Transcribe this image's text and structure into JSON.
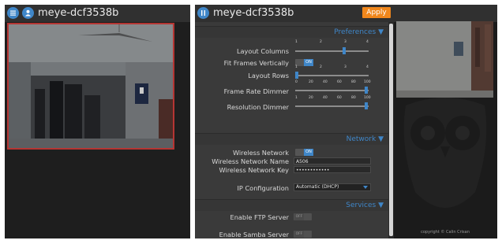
{
  "left": {
    "menu_icon": "hamburger-icon",
    "user_icon": "user-icon",
    "title": "meye-dcf3538b"
  },
  "right": {
    "header": {
      "settings_icon": "pause-icon",
      "title": "meye-dcf3538b",
      "apply_label": "Apply"
    },
    "sections": {
      "preferences": {
        "title": "Preferences",
        "icon": "chevron-down-icon"
      },
      "network": {
        "title": "Network",
        "icon": "chevron-down-icon"
      },
      "services": {
        "title": "Services",
        "icon": "chevron-down-icon"
      }
    },
    "preferences": {
      "layout_columns": {
        "label": "Layout Columns",
        "ticks": [
          "1",
          "2",
          "3",
          "4"
        ],
        "value": 3
      },
      "fit_frames_vertically": {
        "label": "Fit Frames Vertically",
        "state": "ON"
      },
      "layout_rows": {
        "label": "Layout Rows",
        "ticks": [
          "1",
          "2",
          "3",
          "4"
        ],
        "value": 1
      },
      "frame_rate_dimmer": {
        "label": "Frame Rate Dimmer",
        "ticks": [
          "0",
          "20",
          "40",
          "60",
          "80",
          "100"
        ],
        "value": 100
      },
      "resolution_dimmer": {
        "label": "Resolution Dimmer",
        "ticks": [
          "1",
          "20",
          "40",
          "60",
          "80",
          "100"
        ],
        "value": 100
      }
    },
    "network": {
      "wireless_network": {
        "label": "Wireless Network",
        "state": "ON"
      },
      "wireless_network_name": {
        "label": "Wireless Network Name",
        "value": "A506"
      },
      "wireless_network_key": {
        "label": "Wireless Network Key",
        "value": "••••••••••••"
      },
      "ip_configuration": {
        "label": "IP Configuration",
        "value": "Automatic (DHCP)"
      }
    },
    "services": {
      "enable_ftp_server": {
        "label": "Enable FTP Server",
        "state": "OFF"
      },
      "enable_samba_server": {
        "label": "Enable Samba Server",
        "state": "OFF"
      }
    },
    "copyright": "copyright © Calin Crisan"
  },
  "colors": {
    "accent": "#3f86c8",
    "apply": "#f0871c",
    "camera_border": "#b53533"
  }
}
